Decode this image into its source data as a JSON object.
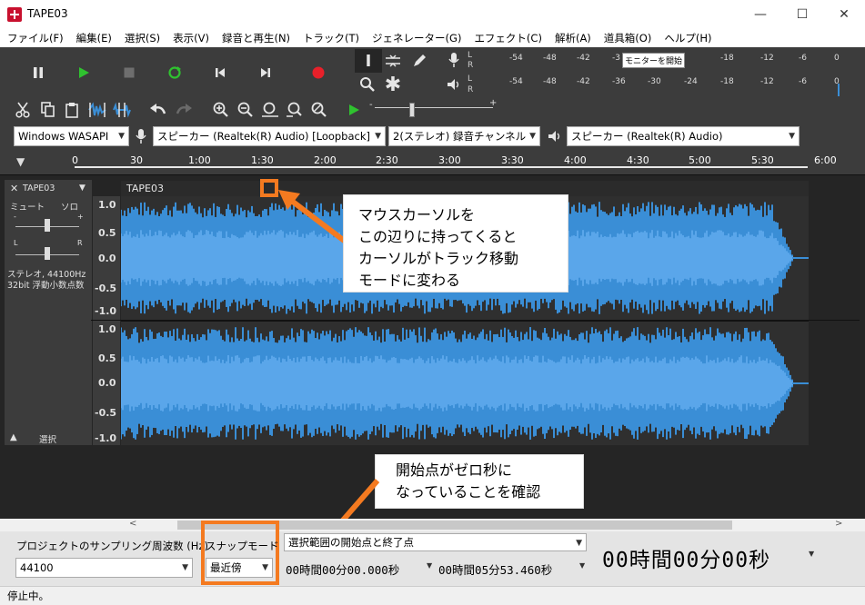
{
  "window": {
    "title": "TAPE03",
    "minimize": "—",
    "maximize": "☐",
    "close": "✕"
  },
  "menus": [
    "ファイル(F)",
    "編集(E)",
    "選択(S)",
    "表示(V)",
    "録音と再生(N)",
    "トラック(T)",
    "ジェネレーター(G)",
    "エフェクト(C)",
    "解析(A)",
    "道具箱(O)",
    "ヘルプ(H)"
  ],
  "meters": {
    "record_ticks": [
      "-54",
      "-48",
      "-42",
      "-3",
      "-18",
      "-12",
      "-6",
      "0"
    ],
    "play_ticks": [
      "-54",
      "-48",
      "-42",
      "-36",
      "-30",
      "-24",
      "-18",
      "-12",
      "-6",
      "0"
    ],
    "monitor_label": "モニターを開始",
    "L": "L",
    "R": "R"
  },
  "devices": {
    "host": "Windows WASAPI",
    "input": "スピーカー (Realtek(R) Audio) [Loopback]",
    "channels": "2(ステレオ) 録音チャンネル",
    "output": "スピーカー (Realtek(R) Audio)"
  },
  "ruler": [
    "0",
    "30",
    "1:00",
    "1:30",
    "2:00",
    "2:30",
    "3:00",
    "3:30",
    "4:00",
    "4:30",
    "5:00",
    "5:30",
    "6:00"
  ],
  "track": {
    "name": "TAPE03",
    "header_name": "TAPE03",
    "mute": "ミュート",
    "solo": "ソロ",
    "gain_minus": "-",
    "gain_plus": "+",
    "pan_L": "L",
    "pan_R": "R",
    "format_line1": "ステレオ, 44100Hz",
    "format_line2": "32bit 浮動小数点数",
    "select": "選択",
    "y_labels": [
      "1.0",
      "0.5",
      "0.0",
      "-0.5",
      "-1.0"
    ]
  },
  "callouts": {
    "top": [
      "マウスカーソルを",
      "この辺りに持ってくると",
      "カーソルがトラック移動",
      "モードに変わる"
    ],
    "bottom": [
      "開始点がゼロ秒に",
      "なっていることを確認"
    ]
  },
  "selection_toolbar": {
    "rate_label": "プロジェクトのサンプリング周波数 (Hz)",
    "rate_value": "44100",
    "snap_label": "スナップモード",
    "snap_value": "最近傍",
    "range_mode": "選択範囲の開始点と終了点",
    "start_time": "00時間00分00.000秒",
    "end_time": "00時間05分53.460秒",
    "big_time": "00時間00分00秒"
  },
  "status": "停止中。",
  "colors": {
    "wave": "#3a8ed6",
    "highlight": "#f47a20",
    "bg": "#252525"
  }
}
